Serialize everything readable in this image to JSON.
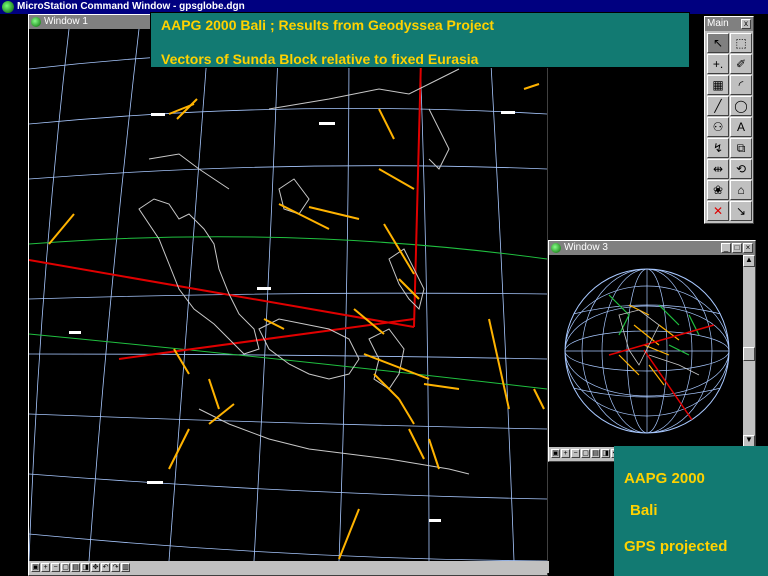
{
  "app": {
    "title": "MicroStation Command Window - gpsglobe.dgn"
  },
  "window1": {
    "title": "Window 1"
  },
  "window3": {
    "title": "Window 3"
  },
  "banner": {
    "line1": "AAPG 2000 Bali ; Results from Geodyssea Project",
    "line2": "Vectors of Sunda Block relative to fixed Eurasia"
  },
  "main_palette": {
    "title": "Main",
    "close": "x"
  },
  "tools": [
    {
      "icon": "arrow-select-icon",
      "glyph": "↖"
    },
    {
      "icon": "fence-icon",
      "glyph": "⬚"
    },
    {
      "icon": "place-point-icon",
      "glyph": "+."
    },
    {
      "icon": "measure-icon",
      "glyph": "✐"
    },
    {
      "icon": "grid-cell-icon",
      "glyph": "▦"
    },
    {
      "icon": "arc-tool-icon",
      "glyph": "◜"
    },
    {
      "icon": "line-tool-icon",
      "glyph": "╱"
    },
    {
      "icon": "ellipse-tool-icon",
      "glyph": "◯"
    },
    {
      "icon": "group-icon",
      "glyph": "⚇"
    },
    {
      "icon": "text-tool-icon",
      "glyph": "A"
    },
    {
      "icon": "modify-icon",
      "glyph": "↯"
    },
    {
      "icon": "copy-icon",
      "glyph": "⧉"
    },
    {
      "icon": "scale-icon",
      "glyph": "⇹"
    },
    {
      "icon": "rotate-icon",
      "glyph": "⟲"
    },
    {
      "icon": "attributes-icon",
      "glyph": "❀"
    },
    {
      "icon": "cell-icon",
      "glyph": "⌂"
    },
    {
      "icon": "delete-icon",
      "glyph": "✕"
    },
    {
      "icon": "drop-icon",
      "glyph": "↘"
    }
  ],
  "info_box": {
    "line1": "AAPG 2000",
    "line2": "Bali",
    "line3": "GPS projected"
  },
  "colors": {
    "banner_bg": "#127a72",
    "banner_text": "#ffd200",
    "vector": "#ffb300",
    "plate_boundary": "#e00000",
    "graticule": "#a8c8ff",
    "equator": "#20c040"
  }
}
